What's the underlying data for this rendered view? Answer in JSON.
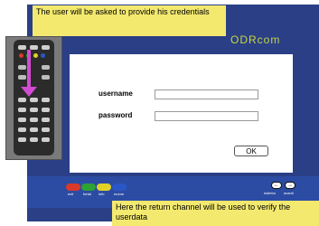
{
  "callouts": {
    "top": "The user will be asked to provide his credentials",
    "bottom": "Here the return channel will be used to verify the userdata"
  },
  "tv": {
    "brand": "ODRcom"
  },
  "login": {
    "username_label": "username",
    "password_label": "password",
    "username_value": "",
    "password_value": "",
    "ok_label": "OK"
  },
  "bottom_controls": {
    "color_buttons": [
      {
        "label": "exit",
        "color": "#d83a2a"
      },
      {
        "label": "fortal",
        "color": "#2fa235"
      },
      {
        "label": "info",
        "color": "#e0d326"
      },
      {
        "label": "mome",
        "color": "#2a57c7"
      }
    ],
    "nav_labels": {
      "left": "indietro",
      "right": "avanti"
    }
  },
  "colors": {
    "tv_blue": "#2a3f86",
    "callout_yellow": "#f3e96f",
    "arrow_pink": "#d24bd2"
  }
}
